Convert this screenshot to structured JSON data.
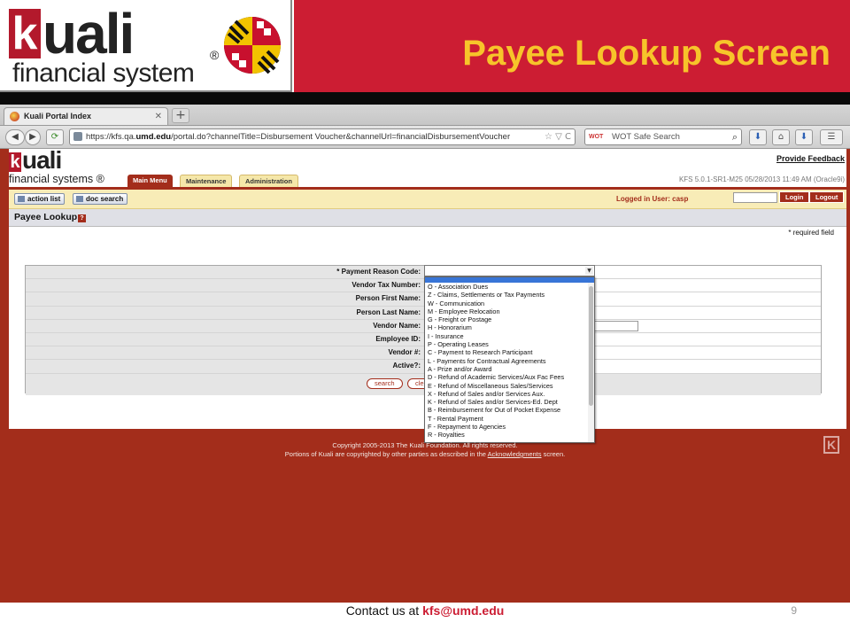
{
  "slide": {
    "logo_k": "k",
    "logo_rest": "uali",
    "logo_reg": "®",
    "logo_subtitle": "financial system",
    "title": "Payee Lookup Screen"
  },
  "browser": {
    "tab_title": "Kuali Portal Index",
    "url_prefix": "https://kfs.qa.",
    "url_domain": "umd.edu",
    "url_rest": "/portal.do?channelTitle=Disbursement Voucher&channelUrl=financialDisbursementVoucher",
    "search_badge": "WOT",
    "search_placeholder": "WOT Safe Search"
  },
  "kfs": {
    "logo_k": "k",
    "logo_rest": "uali",
    "logo_subtitle": "financial systems ®",
    "provide_feedback": "Provide Feedback",
    "version": "KFS 5.0.1-SR1-M25 05/28/2013 11:49 AM (Oracle9i)",
    "tabs": [
      {
        "label": "Main Menu"
      },
      {
        "label": "Maintenance"
      },
      {
        "label": "Administration"
      }
    ],
    "action_list": "action list",
    "doc_search": "doc search",
    "logged_in": "Logged in User: casp",
    "login": "Login",
    "logout": "Logout",
    "page_title": "Payee Lookup",
    "help": "?",
    "required_note": "* required field"
  },
  "form": {
    "labels": [
      "* Payment Reason Code:",
      "Vendor Tax Number:",
      "Person First Name:",
      "Person Last Name:",
      "Vendor Name:",
      "Employee ID:",
      "Vendor #:",
      "Active?:"
    ],
    "search_button": "search",
    "clear_button": "cle"
  },
  "dropdown": {
    "options": [
      "O - Association Dues",
      "Z - Claims, Settlements or Tax Payments",
      "W - Communication",
      "M - Employee Relocation",
      "G - Freight or Postage",
      "H - Honorarium",
      "I - Insurance",
      "P - Operating Leases",
      "C - Payment to Research Participant",
      "L - Payments for Contractual Agreements",
      "A - Prize and/or Award",
      "D - Refund of Academic Services/Aux Fac Fees",
      "E - Refund of Miscellaneous Sales/Services",
      "X - Refund of Sales and/or Services Aux.",
      "K - Refund of Sales and/or Services-Ed. Dept",
      "B - Reimbursement for Out of Pocket Expense",
      "T - Rental Payment",
      "F - Repayment to Agencies",
      "R - Royalties"
    ]
  },
  "copyright": {
    "line1": "Copyright 2005-2013 The Kuali Foundation. All rights reserved.",
    "line2_pre": "Portions of Kuali are copyrighted by other parties as described in the",
    "line2_link": "Acknowledgments",
    "line2_post": "screen."
  },
  "footer": {
    "contact_prefix": "Contact us at",
    "email": "kfs@umd.edu",
    "page_number": "9"
  },
  "colors": {
    "banner_red": "#cc1d33",
    "title_gold": "#f7c42a",
    "kfs_red": "#a32d1b"
  }
}
